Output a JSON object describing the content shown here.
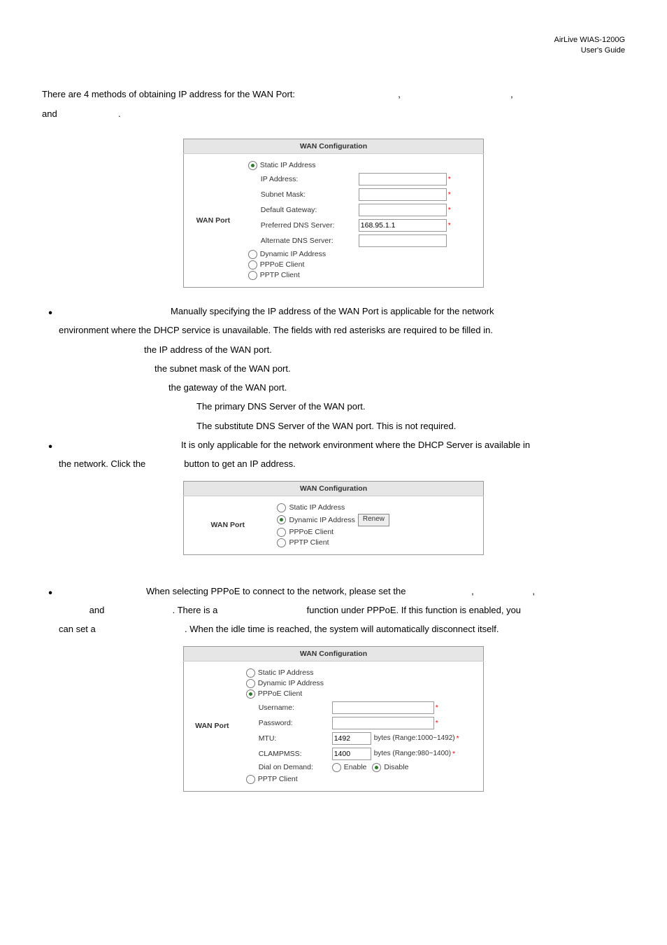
{
  "header": {
    "line1": "AirLive WIAS-1200G",
    "line2": "User's Guide"
  },
  "intro": {
    "line1": "There are 4 methods of obtaining IP address for the WAN Port:",
    "comma": ",",
    "line2": "and",
    "period": "."
  },
  "table1": {
    "title": "WAN Configuration",
    "rowLabel": "WAN Port",
    "opt1": "Static IP Address",
    "f1": "IP Address:",
    "f2": "Subnet Mask:",
    "f3": "Default Gateway:",
    "f4": "Preferred DNS Server:",
    "f4val": "168.95.1.1",
    "f5": "Alternate DNS Server:",
    "opt2": "Dynamic IP Address",
    "opt3": "PPPoE Client",
    "opt4": "PPTP Client"
  },
  "staticIp": {
    "intro": "Manually specifying the IP address of the WAN Port is applicable for the network",
    "intro2": "environment where the DHCP service is unavailable. The fields with red asterisks are required to be filled in.",
    "s1": "the IP address of the WAN port.",
    "s2": "the subnet mask of the WAN port.",
    "s3": "the gateway of the WAN port.",
    "s4": "The primary DNS Server of the WAN port.",
    "s5": "The substitute DNS Server of the WAN port. This is not required."
  },
  "dynamicIp": {
    "intro": "It is only applicable for the network environment where the DHCP Server is available in",
    "intro2a": "the network. Click the",
    "intro2b": "button to get an IP address."
  },
  "table2": {
    "title": "WAN Configuration",
    "rowLabel": "WAN Port",
    "opt1": "Static IP Address",
    "opt2": "Dynamic IP Address",
    "btn": "Renew",
    "opt3": "PPPoE Client",
    "opt4": "PPTP Client"
  },
  "pppoe": {
    "intro": "When selecting PPPoE to connect to the network, please set the",
    "l2a": "and",
    "l2b": ". There is a",
    "l2c": "function under PPPoE. If this function is enabled, you",
    "l3a": "can set a",
    "l3b": ". When the idle time is reached, the system will automatically disconnect itself."
  },
  "table3": {
    "title": "WAN Configuration",
    "rowLabel": "WAN Port",
    "opt1": "Static IP Address",
    "opt2": "Dynamic IP Address",
    "opt3": "PPPoE Client",
    "f1": "Username:",
    "f2": "Password:",
    "f3": "MTU:",
    "f3val": "1492",
    "f3note": "bytes (Range:1000~1492)",
    "f4": "CLAMPMSS:",
    "f4val": "1400",
    "f4note": "bytes (Range:980~1400)",
    "f5": "Dial on Demand:",
    "f5a": "Enable",
    "f5b": "Disable",
    "opt4": "PPTP Client"
  }
}
